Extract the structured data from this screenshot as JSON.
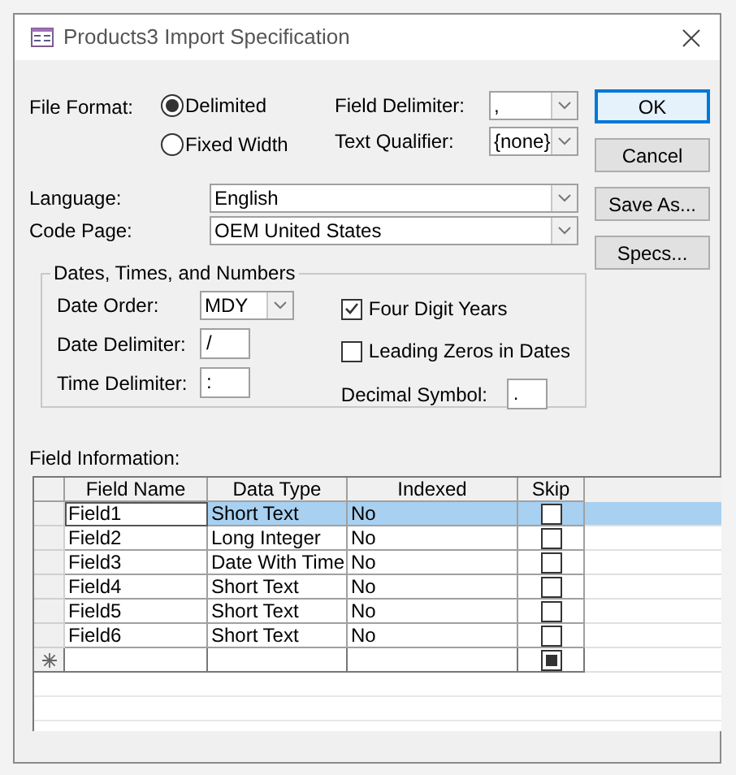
{
  "window": {
    "title": "Products3 Import Specification"
  },
  "file_format": {
    "label": "File Format:",
    "options": [
      {
        "label": "Delimited",
        "selected": true
      },
      {
        "label": "Fixed Width",
        "selected": false
      }
    ]
  },
  "field_delimiter": {
    "label": "Field Delimiter:",
    "value": ","
  },
  "text_qualifier": {
    "label": "Text Qualifier:",
    "value": "{none}"
  },
  "language": {
    "label": "Language:",
    "value": "English"
  },
  "code_page": {
    "label": "Code Page:",
    "value": "OEM United States"
  },
  "buttons": [
    {
      "label": "OK",
      "default": true
    },
    {
      "label": "Cancel",
      "default": false
    },
    {
      "label": "Save As...",
      "default": false
    },
    {
      "label": "Specs...",
      "default": false
    }
  ],
  "dates_group": {
    "title": "Dates, Times, and Numbers",
    "date_order": {
      "label": "Date Order:",
      "value": "MDY"
    },
    "date_delimiter": {
      "label": "Date Delimiter:",
      "value": "/"
    },
    "time_delimiter": {
      "label": "Time Delimiter:",
      "value": ":"
    },
    "four_digit_years": {
      "label": "Four Digit Years",
      "checked": true
    },
    "leading_zeros": {
      "label": "Leading Zeros in Dates",
      "checked": false
    },
    "decimal_symbol": {
      "label": "Decimal Symbol:",
      "value": "."
    }
  },
  "field_information": {
    "label": "Field Information:",
    "columns": [
      "Field Name",
      "Data Type",
      "Indexed",
      "Skip"
    ],
    "rows": [
      {
        "field_name": "Field1",
        "data_type": "Short Text",
        "indexed": "No",
        "skip": false,
        "selected": true
      },
      {
        "field_name": "Field2",
        "data_type": "Long Integer",
        "indexed": "No",
        "skip": false,
        "selected": false
      },
      {
        "field_name": "Field3",
        "data_type": "Date With Time",
        "indexed": "No",
        "skip": false,
        "selected": false
      },
      {
        "field_name": "Field4",
        "data_type": "Short Text",
        "indexed": "No",
        "skip": false,
        "selected": false
      },
      {
        "field_name": "Field5",
        "data_type": "Short Text",
        "indexed": "No",
        "skip": false,
        "selected": false
      },
      {
        "field_name": "Field6",
        "data_type": "Short Text",
        "indexed": "No",
        "skip": false,
        "selected": false
      }
    ],
    "new_row": {
      "skip_indeterminate": true
    }
  }
}
